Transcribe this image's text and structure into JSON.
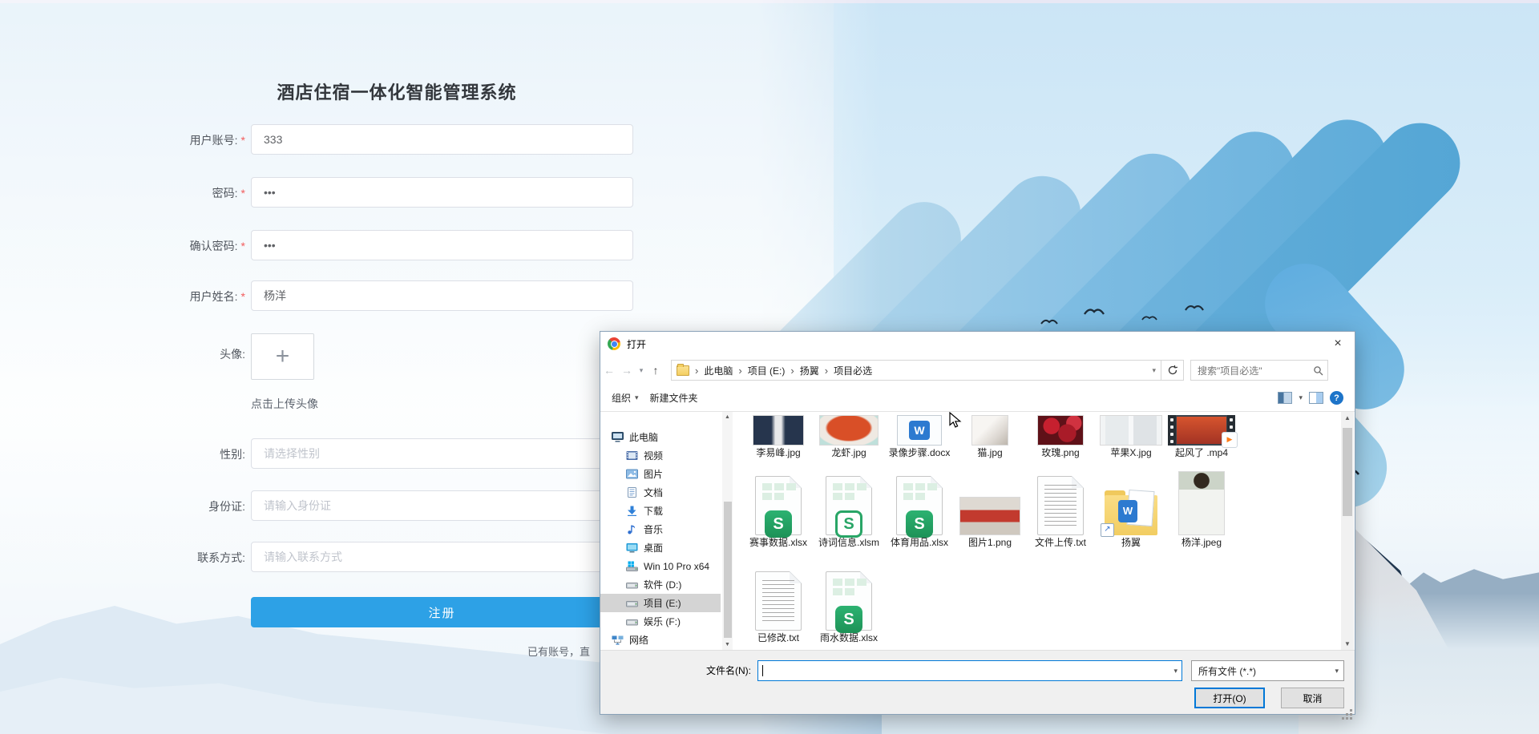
{
  "register": {
    "title": "酒店住宿一体化智能管理系统",
    "required_mark": "*",
    "fields": {
      "account": {
        "label": "用户账号:",
        "value": "333"
      },
      "password": {
        "label": "密码:",
        "value": "•••"
      },
      "confirm_password": {
        "label": "确认密码:",
        "value": "•••"
      },
      "username": {
        "label": "用户姓名:",
        "value": "杨洋"
      },
      "avatar": {
        "label": "头像:",
        "upload_hint": "点击上传头像"
      },
      "gender": {
        "label": "性别:",
        "placeholder": "请选择性别"
      },
      "id_card": {
        "label": "身份证:",
        "placeholder": "请输入身份证"
      },
      "contact": {
        "label": "联系方式:",
        "placeholder": "请输入联系方式"
      }
    },
    "submit_label": "注册",
    "footer_text": "已有账号，直"
  },
  "dialog": {
    "title": "打开",
    "address": {
      "breadcrumb": [
        "此电脑",
        "项目 (E:)",
        "扬翼",
        "项目必选"
      ],
      "search_placeholder": "搜索\"项目必选\""
    },
    "toolbar": {
      "organize": "组织",
      "new_folder": "新建文件夹"
    },
    "sidebar": [
      {
        "label": "此电脑",
        "icon": "computer-icon"
      },
      {
        "label": "视频",
        "icon": "videos-icon"
      },
      {
        "label": "图片",
        "icon": "pictures-icon"
      },
      {
        "label": "文档",
        "icon": "documents-icon"
      },
      {
        "label": "下载",
        "icon": "downloads-icon"
      },
      {
        "label": "音乐",
        "icon": "music-icon"
      },
      {
        "label": "桌面",
        "icon": "desktop-icon"
      },
      {
        "label": "Win 10 Pro x64",
        "icon": "system-drive-icon"
      },
      {
        "label": "软件 (D:)",
        "icon": "drive-icon"
      },
      {
        "label": "项目 (E:)",
        "icon": "drive-icon",
        "selected": true
      },
      {
        "label": "娱乐 (F:)",
        "icon": "drive-icon"
      },
      {
        "label": "网络",
        "icon": "network-icon"
      }
    ],
    "files": {
      "row1": [
        {
          "name": "李易峰.jpg",
          "icon": "photo-thumbnail"
        },
        {
          "name": "龙虾.jpg",
          "icon": "photo-thumbnail"
        },
        {
          "name": "录像步骤.docx",
          "icon": "word-doc-icon"
        },
        {
          "name": "猫.jpg",
          "icon": "photo-thumbnail"
        },
        {
          "name": "玫瑰.png",
          "icon": "photo-thumbnail"
        },
        {
          "name": "苹果X.jpg",
          "icon": "photo-thumbnail"
        },
        {
          "name": "起风了 .mp4",
          "icon": "video-thumbnail"
        }
      ],
      "row2": [
        {
          "name": "赛事数据.xlsx",
          "icon": "spreadsheet-icon"
        },
        {
          "name": "诗词信息.xlsm",
          "icon": "spreadsheet-macro-icon"
        },
        {
          "name": "体育用品.xlsx",
          "icon": "spreadsheet-icon"
        },
        {
          "name": "图片1.png",
          "icon": "photo-thumbnail"
        },
        {
          "name": "文件上传.txt",
          "icon": "text-file-icon"
        },
        {
          "name": "扬翼",
          "icon": "folder-shortcut-icon"
        },
        {
          "name": "杨洋.jpeg",
          "icon": "photo-thumbnail"
        }
      ],
      "row3": [
        {
          "name": "已修改.txt",
          "icon": "text-file-icon"
        },
        {
          "name": "雨水数据.xlsx",
          "icon": "spreadsheet-icon"
        }
      ]
    },
    "footer": {
      "filename_label": "文件名(N):",
      "filename_value": "",
      "filetype_value": "所有文件 (*.*)",
      "open_label": "打开(O)",
      "cancel_label": "取消"
    }
  },
  "glyphs": {
    "plus": "+",
    "close": "×",
    "back": "←",
    "forward": "→",
    "up": "↑",
    "caret_down": "▾",
    "crumb_sep": "›",
    "help": "?",
    "spreadsheet_letter": "S",
    "word_letter": "W",
    "play": "▶",
    "scroll_up": "▲",
    "scroll_down": "▼",
    "shortcut_arrow": "↗"
  },
  "colors": {
    "accent_blue": "#2da1e6",
    "focus_blue": "#0078d7",
    "excel_green": "#24a164",
    "word_blue": "#2d7ad0",
    "folder_yellow": "#f9d874",
    "required_red": "#f25c5c"
  }
}
